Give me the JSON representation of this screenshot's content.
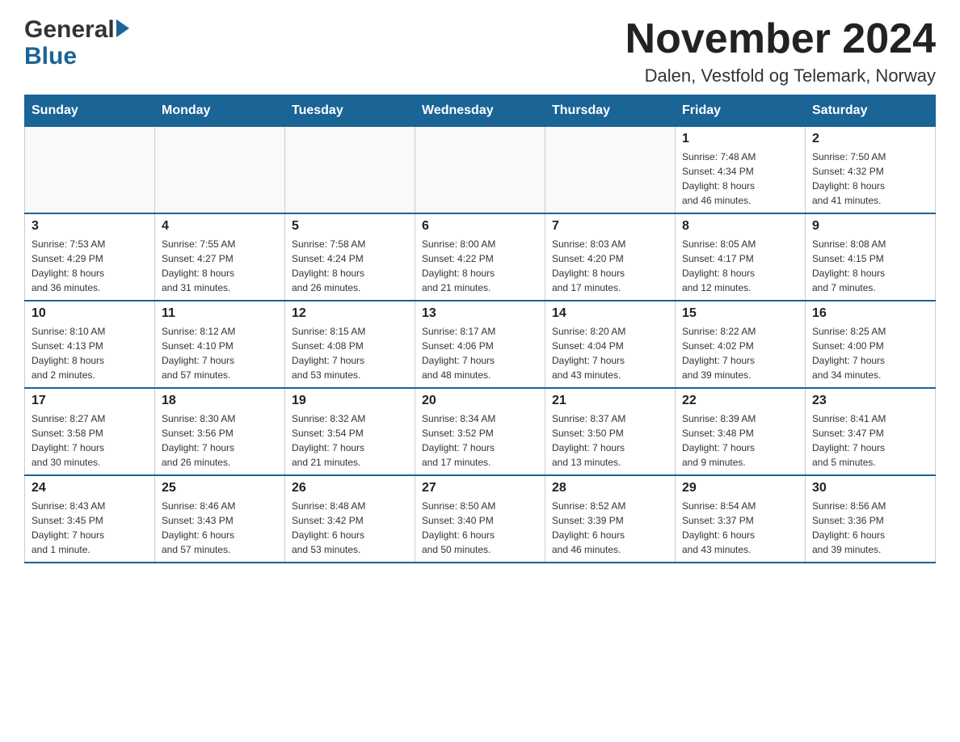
{
  "header": {
    "title": "November 2024",
    "subtitle": "Dalen, Vestfold og Telemark, Norway"
  },
  "logo": {
    "general": "General",
    "blue": "Blue"
  },
  "weekdays": [
    "Sunday",
    "Monday",
    "Tuesday",
    "Wednesday",
    "Thursday",
    "Friday",
    "Saturday"
  ],
  "weeks": [
    [
      {
        "day": "",
        "info": ""
      },
      {
        "day": "",
        "info": ""
      },
      {
        "day": "",
        "info": ""
      },
      {
        "day": "",
        "info": ""
      },
      {
        "day": "",
        "info": ""
      },
      {
        "day": "1",
        "info": "Sunrise: 7:48 AM\nSunset: 4:34 PM\nDaylight: 8 hours\nand 46 minutes."
      },
      {
        "day": "2",
        "info": "Sunrise: 7:50 AM\nSunset: 4:32 PM\nDaylight: 8 hours\nand 41 minutes."
      }
    ],
    [
      {
        "day": "3",
        "info": "Sunrise: 7:53 AM\nSunset: 4:29 PM\nDaylight: 8 hours\nand 36 minutes."
      },
      {
        "day": "4",
        "info": "Sunrise: 7:55 AM\nSunset: 4:27 PM\nDaylight: 8 hours\nand 31 minutes."
      },
      {
        "day": "5",
        "info": "Sunrise: 7:58 AM\nSunset: 4:24 PM\nDaylight: 8 hours\nand 26 minutes."
      },
      {
        "day": "6",
        "info": "Sunrise: 8:00 AM\nSunset: 4:22 PM\nDaylight: 8 hours\nand 21 minutes."
      },
      {
        "day": "7",
        "info": "Sunrise: 8:03 AM\nSunset: 4:20 PM\nDaylight: 8 hours\nand 17 minutes."
      },
      {
        "day": "8",
        "info": "Sunrise: 8:05 AM\nSunset: 4:17 PM\nDaylight: 8 hours\nand 12 minutes."
      },
      {
        "day": "9",
        "info": "Sunrise: 8:08 AM\nSunset: 4:15 PM\nDaylight: 8 hours\nand 7 minutes."
      }
    ],
    [
      {
        "day": "10",
        "info": "Sunrise: 8:10 AM\nSunset: 4:13 PM\nDaylight: 8 hours\nand 2 minutes."
      },
      {
        "day": "11",
        "info": "Sunrise: 8:12 AM\nSunset: 4:10 PM\nDaylight: 7 hours\nand 57 minutes."
      },
      {
        "day": "12",
        "info": "Sunrise: 8:15 AM\nSunset: 4:08 PM\nDaylight: 7 hours\nand 53 minutes."
      },
      {
        "day": "13",
        "info": "Sunrise: 8:17 AM\nSunset: 4:06 PM\nDaylight: 7 hours\nand 48 minutes."
      },
      {
        "day": "14",
        "info": "Sunrise: 8:20 AM\nSunset: 4:04 PM\nDaylight: 7 hours\nand 43 minutes."
      },
      {
        "day": "15",
        "info": "Sunrise: 8:22 AM\nSunset: 4:02 PM\nDaylight: 7 hours\nand 39 minutes."
      },
      {
        "day": "16",
        "info": "Sunrise: 8:25 AM\nSunset: 4:00 PM\nDaylight: 7 hours\nand 34 minutes."
      }
    ],
    [
      {
        "day": "17",
        "info": "Sunrise: 8:27 AM\nSunset: 3:58 PM\nDaylight: 7 hours\nand 30 minutes."
      },
      {
        "day": "18",
        "info": "Sunrise: 8:30 AM\nSunset: 3:56 PM\nDaylight: 7 hours\nand 26 minutes."
      },
      {
        "day": "19",
        "info": "Sunrise: 8:32 AM\nSunset: 3:54 PM\nDaylight: 7 hours\nand 21 minutes."
      },
      {
        "day": "20",
        "info": "Sunrise: 8:34 AM\nSunset: 3:52 PM\nDaylight: 7 hours\nand 17 minutes."
      },
      {
        "day": "21",
        "info": "Sunrise: 8:37 AM\nSunset: 3:50 PM\nDaylight: 7 hours\nand 13 minutes."
      },
      {
        "day": "22",
        "info": "Sunrise: 8:39 AM\nSunset: 3:48 PM\nDaylight: 7 hours\nand 9 minutes."
      },
      {
        "day": "23",
        "info": "Sunrise: 8:41 AM\nSunset: 3:47 PM\nDaylight: 7 hours\nand 5 minutes."
      }
    ],
    [
      {
        "day": "24",
        "info": "Sunrise: 8:43 AM\nSunset: 3:45 PM\nDaylight: 7 hours\nand 1 minute."
      },
      {
        "day": "25",
        "info": "Sunrise: 8:46 AM\nSunset: 3:43 PM\nDaylight: 6 hours\nand 57 minutes."
      },
      {
        "day": "26",
        "info": "Sunrise: 8:48 AM\nSunset: 3:42 PM\nDaylight: 6 hours\nand 53 minutes."
      },
      {
        "day": "27",
        "info": "Sunrise: 8:50 AM\nSunset: 3:40 PM\nDaylight: 6 hours\nand 50 minutes."
      },
      {
        "day": "28",
        "info": "Sunrise: 8:52 AM\nSunset: 3:39 PM\nDaylight: 6 hours\nand 46 minutes."
      },
      {
        "day": "29",
        "info": "Sunrise: 8:54 AM\nSunset: 3:37 PM\nDaylight: 6 hours\nand 43 minutes."
      },
      {
        "day": "30",
        "info": "Sunrise: 8:56 AM\nSunset: 3:36 PM\nDaylight: 6 hours\nand 39 minutes."
      }
    ]
  ]
}
